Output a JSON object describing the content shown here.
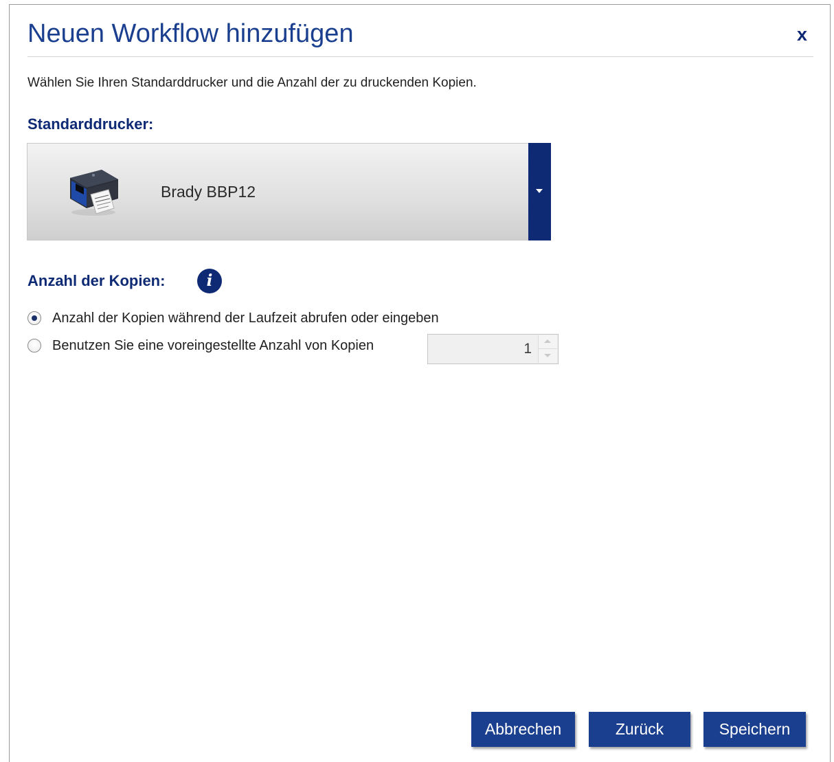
{
  "dialog": {
    "title": "Neuen Workflow hinzufügen",
    "close_label": "x",
    "intro": "Wählen Sie Ihren Standarddrucker und die Anzahl der zu druckenden Kopien."
  },
  "printer": {
    "label": "Standarddrucker:",
    "selected": "Brady BBP12",
    "icon": "printer-image"
  },
  "copies": {
    "label": "Anzahl der Kopien:",
    "info_icon": "i",
    "options": [
      {
        "label": "Anzahl der Kopien während der Laufzeit abrufen oder eingeben",
        "checked": true
      },
      {
        "label": "Benutzen Sie eine voreingestellte Anzahl von Kopien",
        "checked": false
      }
    ],
    "preset_value": "1"
  },
  "buttons": {
    "cancel": "Abbrechen",
    "back": "Zurück",
    "save": "Speichern"
  },
  "colors": {
    "accent": "#1b3f8f",
    "dark_accent": "#0e2a74"
  }
}
